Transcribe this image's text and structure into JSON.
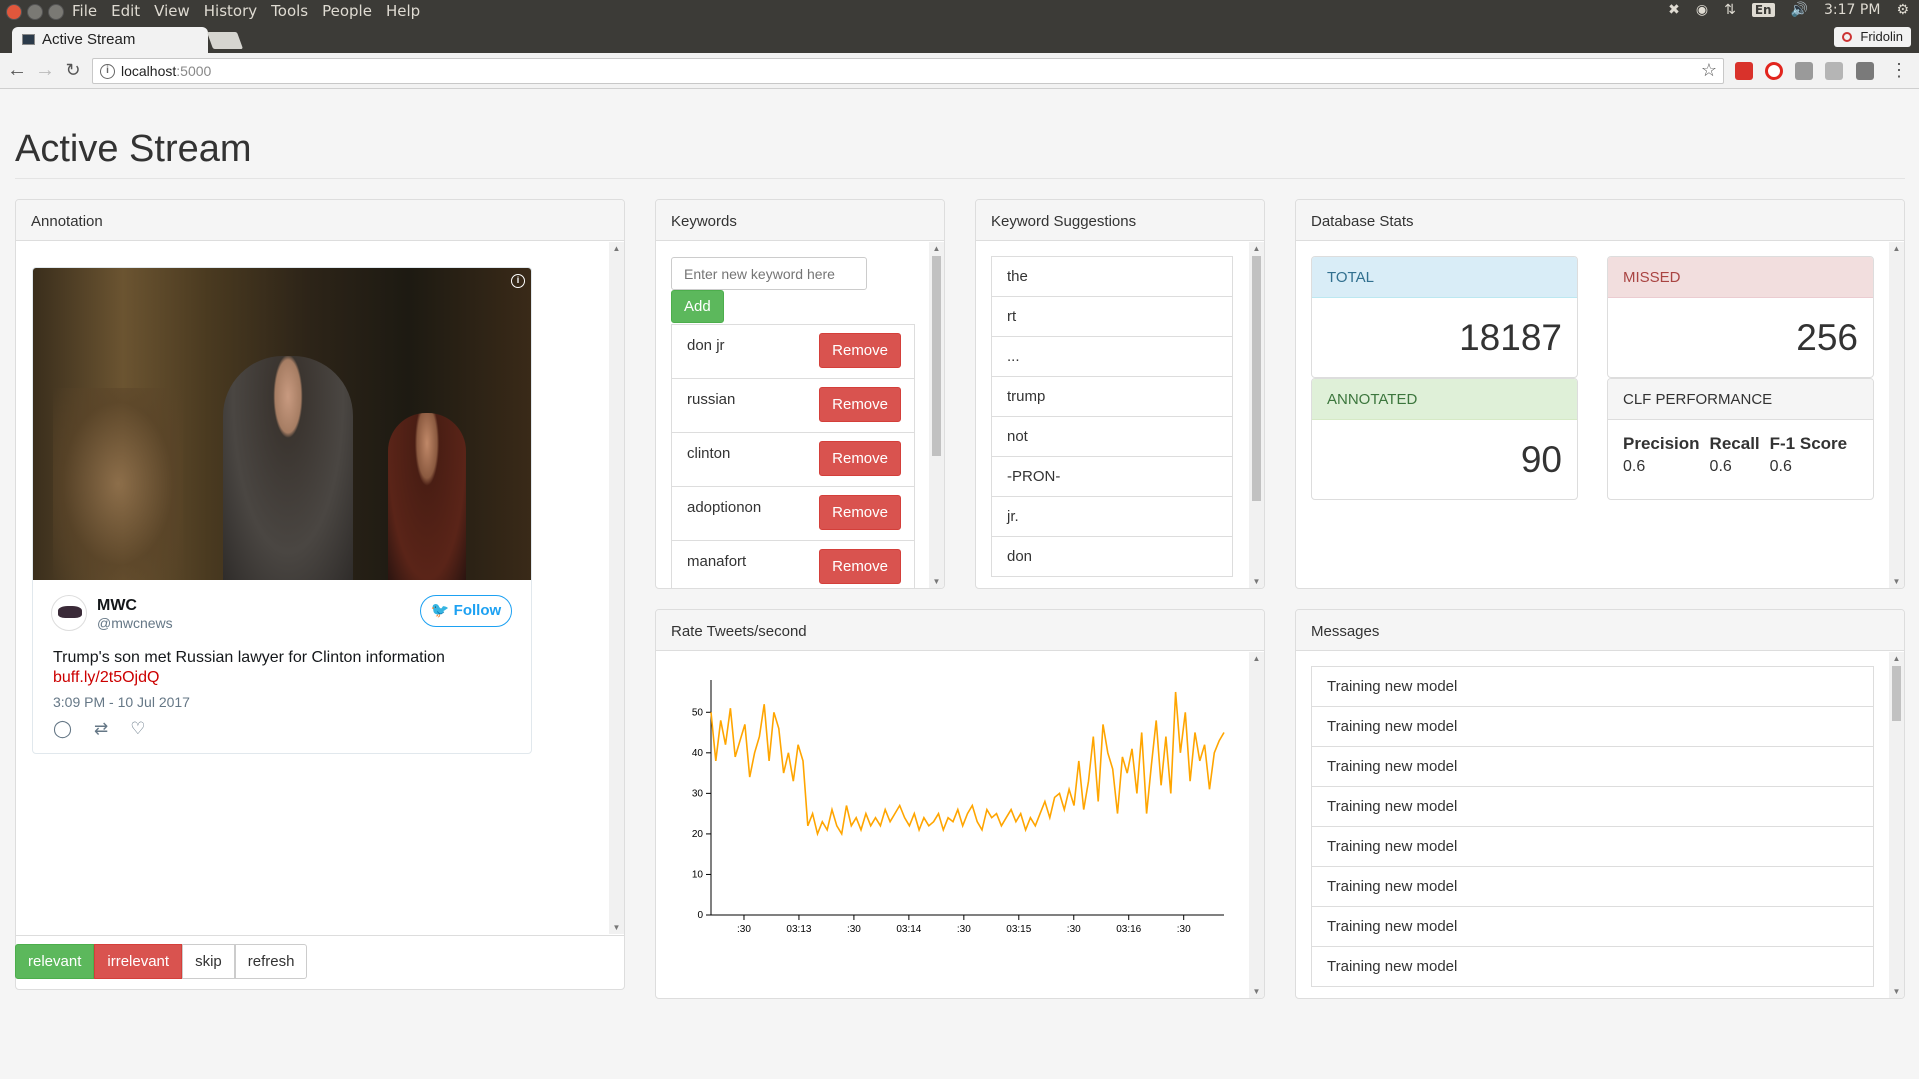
{
  "os": {
    "menu": [
      "File",
      "Edit",
      "View",
      "History",
      "Tools",
      "People",
      "Help"
    ],
    "lang": "En",
    "clock": "3:17 PM"
  },
  "browser": {
    "tab_title": "Active Stream",
    "profile_name": "Fridolin",
    "url_host": "localhost",
    "url_port": ":5000"
  },
  "page": {
    "title": "Active Stream"
  },
  "annotation": {
    "heading": "Annotation",
    "tweet": {
      "name": "MWC",
      "handle": "@mwcnews",
      "follow_label": "Follow",
      "text": "Trump's son met Russian lawyer for Clinton information",
      "link": "buff.ly/2t5OjdQ",
      "time": "3:09 PM - 10 Jul 2017"
    },
    "buttons": {
      "relevant": "relevant",
      "irrelevant": "irrelevant",
      "skip": "skip",
      "refresh": "refresh"
    }
  },
  "keywords": {
    "heading": "Keywords",
    "input_placeholder": "Enter new keyword here",
    "add_label": "Add",
    "remove_label": "Remove",
    "items": [
      "don jr",
      "russian",
      "clinton",
      "adoptionon",
      "manafort"
    ]
  },
  "suggestions": {
    "heading": "Keyword Suggestions",
    "items": [
      "the",
      "rt",
      "...",
      "trump",
      "not",
      "-PRON-",
      "jr.",
      "don"
    ]
  },
  "stats": {
    "heading": "Database Stats",
    "total_label": "TOTAL",
    "total_value": "18187",
    "missed_label": "MISSED",
    "missed_value": "256",
    "annotated_label": "ANNOTATED",
    "annotated_value": "90",
    "perf_label": "CLF PERFORMANCE",
    "precision_label": "Precision",
    "precision_value": "0.6",
    "recall_label": "Recall",
    "recall_value": "0.6",
    "f1_label": "F-1 Score",
    "f1_value": "0.6"
  },
  "rate": {
    "heading": "Rate Tweets/second"
  },
  "messages": {
    "heading": "Messages",
    "items": [
      "Training new model",
      "Training new model",
      "Training new model",
      "Training new model",
      "Training new model",
      "Training new model",
      "Training new model",
      "Training new model"
    ]
  },
  "colors": {
    "line": "#ffa500",
    "success": "#5cb85c",
    "danger": "#d9534f",
    "twitter": "#1da1f2",
    "link": "#cc0000"
  },
  "chart_data": {
    "type": "line",
    "xlabel": "",
    "ylabel": "",
    "ylim": [
      0,
      55
    ],
    "yticks": [
      0,
      10,
      20,
      30,
      40,
      50
    ],
    "xtick_labels": [
      ":30",
      "03:13",
      ":30",
      "03:14",
      ":30",
      "03:15",
      ":30",
      "03:16",
      ":30"
    ],
    "xlim_seconds": [
      0,
      280
    ],
    "xtick_seconds": [
      18,
      48,
      78,
      108,
      138,
      168,
      198,
      228,
      258
    ],
    "series": [
      {
        "values": [
          50,
          38,
          48,
          42,
          51,
          39,
          43,
          47,
          34,
          40,
          44,
          52,
          38,
          50,
          46,
          35,
          40,
          33,
          42,
          38,
          22,
          25,
          20,
          23,
          21,
          26,
          22,
          20,
          27,
          22,
          24,
          21,
          25,
          22,
          24,
          22,
          26,
          23,
          25,
          27,
          24,
          22,
          25,
          21,
          24,
          22,
          23,
          25,
          21,
          24,
          23,
          26,
          22,
          25,
          27,
          23,
          21,
          26,
          24,
          25,
          22,
          24,
          26,
          23,
          25,
          21,
          24,
          22,
          25,
          28,
          24,
          29,
          30,
          26,
          31,
          27,
          38,
          26,
          33,
          44,
          28,
          47,
          40,
          36,
          25,
          39,
          35,
          41,
          30,
          45,
          25,
          37,
          48,
          32,
          44,
          30,
          55,
          40,
          50,
          33,
          45,
          38,
          42,
          31,
          40,
          43,
          45
        ]
      }
    ]
  }
}
